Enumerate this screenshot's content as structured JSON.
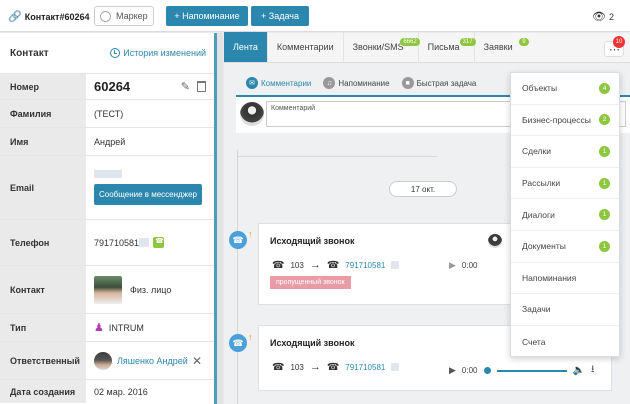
{
  "topbar": {
    "contact_title": "Контакт#60264",
    "marker_label": "Маркер",
    "add_reminder_label": "+ Напоминание",
    "add_task_label": "+ Задача",
    "viewers_count": "2"
  },
  "left": {
    "heading": "Контакт",
    "history_label": "История изменений",
    "fields": {
      "number_label": "Номер",
      "number_value": "60264",
      "surname_label": "Фамилия",
      "surname_value": "(ТЕСТ)",
      "name_label": "Имя",
      "name_value": "Андрей",
      "email_label": "Email",
      "messenger_button": "Сообщение в мессенджер",
      "phone_label": "Телефон",
      "phone_value": "791710581",
      "contact_label": "Контакт",
      "contact_value": "Физ. лицо",
      "type_label": "Тип",
      "type_value": "INTRUM",
      "responsible_label": "Ответственный",
      "responsible_value": "Ляшенко Андрей",
      "created_label": "Дата создания",
      "created_value": "02 мар. 2016"
    }
  },
  "tabs": [
    {
      "label": "Лента",
      "badge": ""
    },
    {
      "label": "Комментарии",
      "badge": ""
    },
    {
      "label": "Звонки/SMS",
      "badge": "6662"
    },
    {
      "label": "Письма",
      "badge": "317"
    },
    {
      "label": "Заявки",
      "badge": "9"
    }
  ],
  "more_badge": "10",
  "subtabs": {
    "comments": "Комментарии",
    "reminder": "Напоминание",
    "quick_task": "Быстрая задача"
  },
  "comment_placeholder": "Комментарий",
  "date_pill": "17 окт.",
  "calls": [
    {
      "title": "Исходящий звонок",
      "from": "103",
      "to": "791710581",
      "status": "пропущенный звонок",
      "time": "0:00"
    },
    {
      "title": "Исходящий звонок",
      "from": "103",
      "to": "791710581",
      "time": "0:00"
    }
  ],
  "dropdown": [
    {
      "label": "Объекты",
      "count": "4"
    },
    {
      "label": "Бизнес-процессы",
      "count": "2"
    },
    {
      "label": "Сделки",
      "count": "1"
    },
    {
      "label": "Рассылки",
      "count": "1"
    },
    {
      "label": "Диалоги",
      "count": "1"
    },
    {
      "label": "Документы",
      "count": "1"
    },
    {
      "label": "Напоминания",
      "count": ""
    },
    {
      "label": "Задачи",
      "count": ""
    },
    {
      "label": "Счета",
      "count": ""
    }
  ],
  "colors": {
    "primary": "#2b87ad",
    "badge_green": "#8dc63f",
    "missed": "#e99ba6",
    "alert": "#e33333"
  }
}
